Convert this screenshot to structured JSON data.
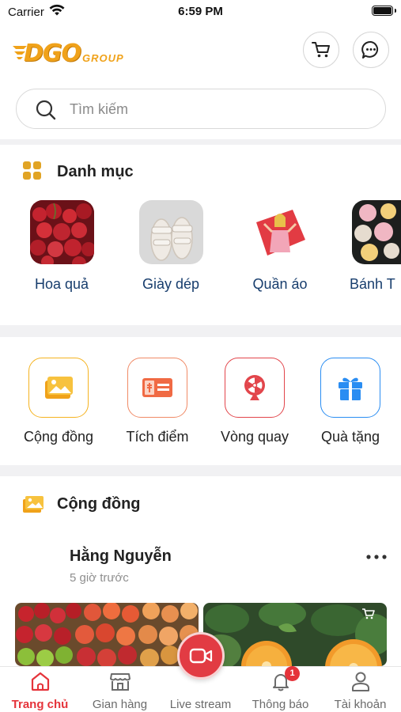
{
  "status_bar": {
    "carrier": "Carrier",
    "time": "6:59 PM"
  },
  "header": {
    "logo_text": "DGO",
    "logo_sub": "GROUP",
    "cart_icon": "cart-icon",
    "chat_icon": "chat-icon"
  },
  "search": {
    "placeholder": "Tìm kiếm"
  },
  "categories": {
    "title": "Danh mục",
    "items": [
      {
        "label": "Hoa quả"
      },
      {
        "label": "Giày dép"
      },
      {
        "label": "Quần áo"
      },
      {
        "label": "Bánh T"
      }
    ]
  },
  "features": {
    "items": [
      {
        "label": "Cộng đồng",
        "color": "#f5b320"
      },
      {
        "label": "Tích điểm",
        "color": "#f08a66"
      },
      {
        "label": "Vòng quay",
        "color": "#e2454b"
      },
      {
        "label": "Quà tặng",
        "color": "#2a8df2"
      }
    ]
  },
  "community": {
    "title": "Cộng đồng",
    "post": {
      "author": "Hằng Nguyễn",
      "time": "5 giờ trước"
    }
  },
  "bottom_nav": {
    "items": [
      {
        "label": "Trang chủ",
        "active": true
      },
      {
        "label": "Gian hàng"
      },
      {
        "label": "Live stream"
      },
      {
        "label": "Thông báo",
        "badge": "1"
      },
      {
        "label": "Tài khoản"
      }
    ]
  },
  "colors": {
    "accent": "#e5333a",
    "brand": "#f0a21a",
    "category_text": "#173d6d"
  }
}
